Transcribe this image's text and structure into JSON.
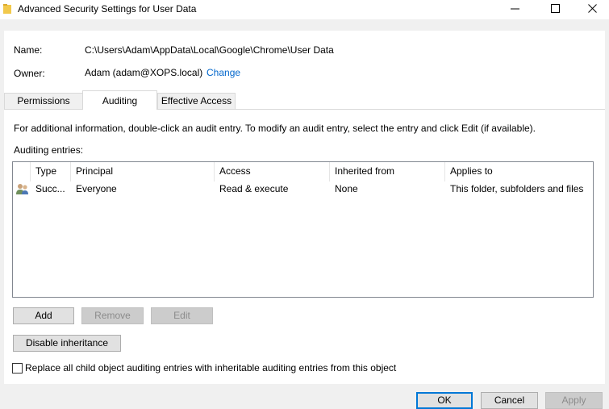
{
  "window": {
    "title": "Advanced Security Settings for User Data",
    "icon": "folder-icon"
  },
  "details": {
    "name_label": "Name:",
    "name_value": "C:\\Users\\Adam\\AppData\\Local\\Google\\Chrome\\User Data",
    "owner_label": "Owner:",
    "owner_value": "Adam (adam@XOPS.local)",
    "change_link": "Change"
  },
  "tabs": [
    {
      "label": "Permissions",
      "active": false
    },
    {
      "label": "Auditing",
      "active": true
    },
    {
      "label": "Effective Access",
      "active": false
    }
  ],
  "auditing": {
    "info_text": "For additional information, double-click an audit entry. To modify an audit entry, select the entry and click Edit (if available).",
    "entries_label": "Auditing entries:",
    "columns": [
      "Type",
      "Principal",
      "Access",
      "Inherited from",
      "Applies to"
    ],
    "rows": [
      {
        "icon": "users-icon",
        "type": "Succ...",
        "principal": "Everyone",
        "access": "Read & execute",
        "inherited_from": "None",
        "applies_to": "This folder, subfolders and files"
      }
    ],
    "add_label": "Add",
    "remove_label": "Remove",
    "edit_label": "Edit",
    "disable_inheritance_label": "Disable inheritance",
    "replace_checkbox_label": "Replace all child object auditing entries with inheritable auditing entries from this object",
    "replace_checked": false
  },
  "footer": {
    "ok_label": "OK",
    "cancel_label": "Cancel",
    "apply_label": "Apply"
  },
  "colors": {
    "link": "#0066cc",
    "accent": "#0078d7",
    "folder": "#f2c94c"
  }
}
